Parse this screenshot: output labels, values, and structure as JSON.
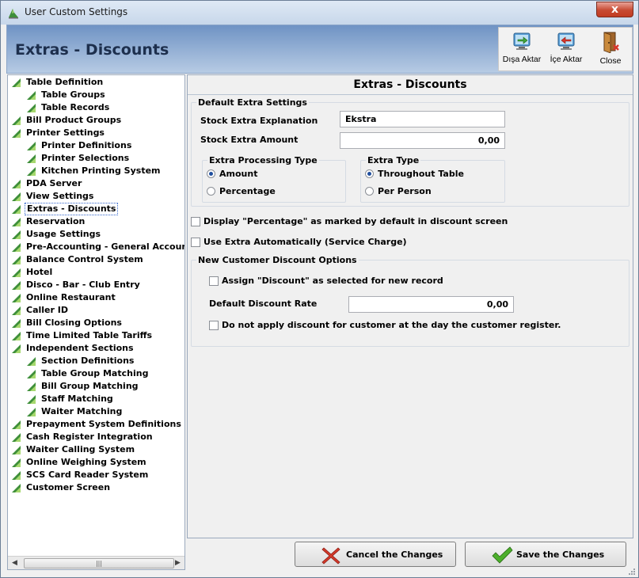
{
  "window": {
    "title": "User Custom Settings",
    "close_label": "x"
  },
  "header": {
    "title": "Extras - Discounts",
    "toolbar": [
      {
        "label": "Dışa Aktar",
        "icon": "export-icon"
      },
      {
        "label": "İçe Aktar",
        "icon": "import-icon"
      },
      {
        "label": "Close",
        "icon": "close-door-icon"
      }
    ]
  },
  "tree": {
    "items": [
      {
        "label": "Table Definition",
        "level": 0
      },
      {
        "label": "Table Groups",
        "level": 1
      },
      {
        "label": "Table Records",
        "level": 1
      },
      {
        "label": "Bill Product Groups",
        "level": 0
      },
      {
        "label": "Printer Settings",
        "level": 0
      },
      {
        "label": "Printer Definitions",
        "level": 1
      },
      {
        "label": "Printer Selections",
        "level": 1
      },
      {
        "label": "Kitchen Printing System",
        "level": 1
      },
      {
        "label": "PDA Server",
        "level": 0
      },
      {
        "label": "View Settings",
        "level": 0
      },
      {
        "label": "Extras - Discounts",
        "level": 0,
        "selected": true
      },
      {
        "label": "Reservation",
        "level": 0
      },
      {
        "label": "Usage Settings",
        "level": 0
      },
      {
        "label": "Pre-Accounting - General Accountin",
        "level": 0
      },
      {
        "label": "Balance Control System",
        "level": 0
      },
      {
        "label": "Hotel",
        "level": 0
      },
      {
        "label": "Disco - Bar - Club Entry",
        "level": 0
      },
      {
        "label": "Online Restaurant",
        "level": 0
      },
      {
        "label": "Caller ID",
        "level": 0
      },
      {
        "label": "Bill Closing Options",
        "level": 0
      },
      {
        "label": "Time Limited Table Tariffs",
        "level": 0
      },
      {
        "label": "Independent Sections",
        "level": 0
      },
      {
        "label": "Section Definitions",
        "level": 1
      },
      {
        "label": "Table Group Matching",
        "level": 1
      },
      {
        "label": "Bill Group Matching",
        "level": 1
      },
      {
        "label": "Staff Matching",
        "level": 1
      },
      {
        "label": "Waiter Matching",
        "level": 1
      },
      {
        "label": "Prepayment System Definitions",
        "level": 0
      },
      {
        "label": "Cash Register Integration",
        "level": 0
      },
      {
        "label": "Waiter Calling System",
        "level": 0
      },
      {
        "label": "Online Weighing System",
        "level": 0
      },
      {
        "label": "SCS Card Reader System",
        "level": 0
      },
      {
        "label": "Customer Screen",
        "level": 0
      }
    ],
    "scroll_thumb_grip": "|||"
  },
  "main": {
    "title": "Extras - Discounts",
    "default_group": {
      "title": "Default Extra Settings",
      "stock_explanation_label": "Stock Extra Explanation",
      "stock_explanation_value": "Ekstra",
      "stock_amount_label": "Stock Extra Amount",
      "stock_amount_value": "0,00",
      "processing_type": {
        "title": "Extra Processing Type",
        "options": [
          {
            "label": "Amount",
            "checked": true
          },
          {
            "label": "Percentage",
            "checked": false
          }
        ]
      },
      "extra_type": {
        "title": "Extra Type",
        "options": [
          {
            "label": "Throughout Table",
            "checked": true
          },
          {
            "label": "Per Person",
            "checked": false
          }
        ]
      }
    },
    "display_percentage_label": "Display \"Percentage\" as marked by default in discount screen",
    "use_extra_auto_label": "Use Extra Automatically (Service Charge)",
    "customer_group": {
      "title": "New Customer Discount Options",
      "assign_discount_label": "Assign \"Discount\" as selected for new record",
      "default_rate_label": "Default Discount Rate",
      "default_rate_value": "0,00",
      "no_discount_label": "Do not apply discount for customer at the day the customer register."
    }
  },
  "buttons": {
    "cancel_label": "Cancel the Changes",
    "save_label": "Save the Changes"
  },
  "colors": {
    "header_gradient_top": "#6f93c4",
    "header_gradient_bottom": "#b7cbe4",
    "close_red": "#c74a32",
    "tree_icon_green": "#3f8f3a",
    "cancel_red": "#d43a2a",
    "save_green": "#4caf2b"
  }
}
